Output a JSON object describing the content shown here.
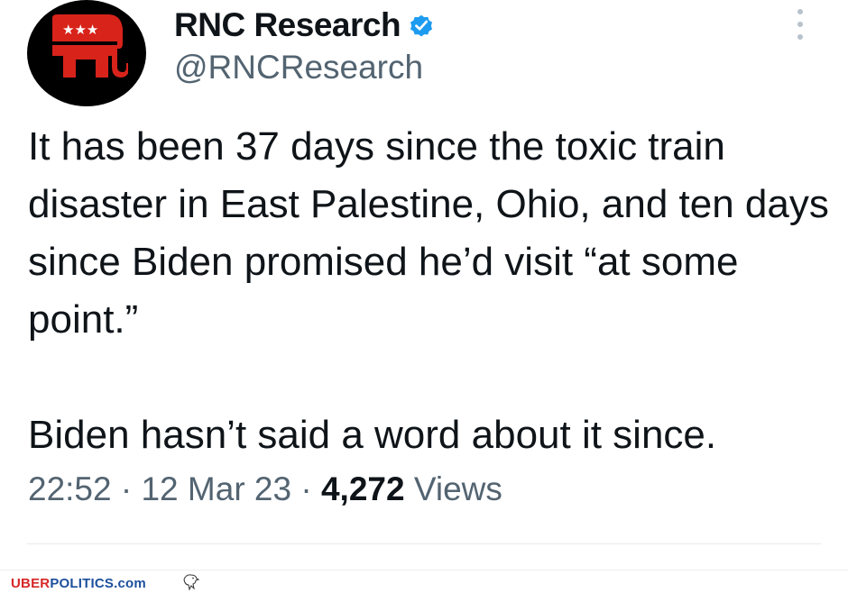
{
  "tweet": {
    "display_name": "RNC Research",
    "handle": "@RNCResearch",
    "text": "It has been 37 days since the toxic train disaster in East Palestine, Ohio, and ten days since Biden promised he’d visit “at some point.”\n\nBiden hasn’t said a word about it since.",
    "time": "22:52",
    "date": "12 Mar 23",
    "separator": "·",
    "views_count": "4,272",
    "views_label": "Views",
    "verified": true,
    "icons": {
      "avatar": "gop-elephant-logo",
      "verified": "verified-badge-icon",
      "more": "more-vertical-icon"
    }
  },
  "watermark": {
    "uber": "UBER",
    "politics": "POLITICS",
    "com": ".com",
    "logo": "eagle-icon"
  },
  "colors": {
    "text_primary": "#0f1419",
    "text_secondary": "#536471",
    "verified_blue": "#1d9bf0",
    "gop_red": "#d8231b",
    "watermark_red": "#d62828",
    "watermark_blue": "#1d4f9c"
  }
}
